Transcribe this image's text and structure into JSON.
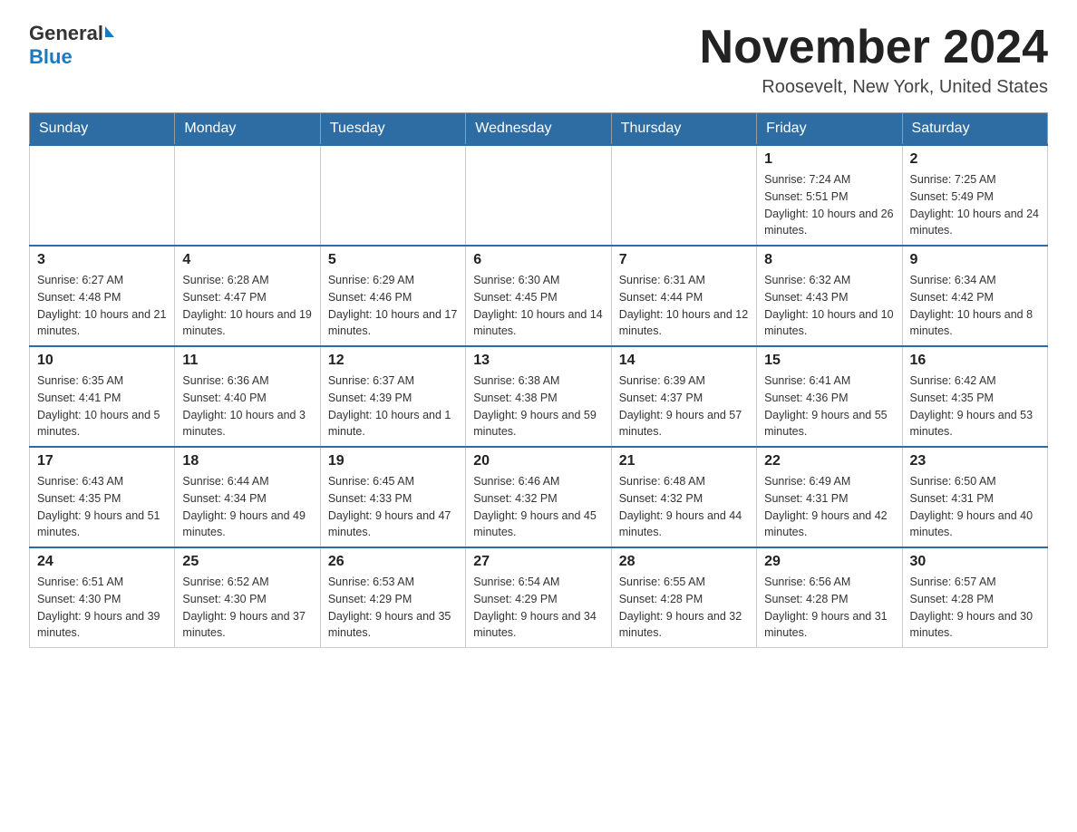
{
  "logo": {
    "general": "General",
    "blue": "Blue"
  },
  "title": "November 2024",
  "location": "Roosevelt, New York, United States",
  "days_of_week": [
    "Sunday",
    "Monday",
    "Tuesday",
    "Wednesday",
    "Thursday",
    "Friday",
    "Saturday"
  ],
  "weeks": [
    [
      {
        "day": "",
        "info": ""
      },
      {
        "day": "",
        "info": ""
      },
      {
        "day": "",
        "info": ""
      },
      {
        "day": "",
        "info": ""
      },
      {
        "day": "",
        "info": ""
      },
      {
        "day": "1",
        "info": "Sunrise: 7:24 AM\nSunset: 5:51 PM\nDaylight: 10 hours and 26 minutes."
      },
      {
        "day": "2",
        "info": "Sunrise: 7:25 AM\nSunset: 5:49 PM\nDaylight: 10 hours and 24 minutes."
      }
    ],
    [
      {
        "day": "3",
        "info": "Sunrise: 6:27 AM\nSunset: 4:48 PM\nDaylight: 10 hours and 21 minutes."
      },
      {
        "day": "4",
        "info": "Sunrise: 6:28 AM\nSunset: 4:47 PM\nDaylight: 10 hours and 19 minutes."
      },
      {
        "day": "5",
        "info": "Sunrise: 6:29 AM\nSunset: 4:46 PM\nDaylight: 10 hours and 17 minutes."
      },
      {
        "day": "6",
        "info": "Sunrise: 6:30 AM\nSunset: 4:45 PM\nDaylight: 10 hours and 14 minutes."
      },
      {
        "day": "7",
        "info": "Sunrise: 6:31 AM\nSunset: 4:44 PM\nDaylight: 10 hours and 12 minutes."
      },
      {
        "day": "8",
        "info": "Sunrise: 6:32 AM\nSunset: 4:43 PM\nDaylight: 10 hours and 10 minutes."
      },
      {
        "day": "9",
        "info": "Sunrise: 6:34 AM\nSunset: 4:42 PM\nDaylight: 10 hours and 8 minutes."
      }
    ],
    [
      {
        "day": "10",
        "info": "Sunrise: 6:35 AM\nSunset: 4:41 PM\nDaylight: 10 hours and 5 minutes."
      },
      {
        "day": "11",
        "info": "Sunrise: 6:36 AM\nSunset: 4:40 PM\nDaylight: 10 hours and 3 minutes."
      },
      {
        "day": "12",
        "info": "Sunrise: 6:37 AM\nSunset: 4:39 PM\nDaylight: 10 hours and 1 minute."
      },
      {
        "day": "13",
        "info": "Sunrise: 6:38 AM\nSunset: 4:38 PM\nDaylight: 9 hours and 59 minutes."
      },
      {
        "day": "14",
        "info": "Sunrise: 6:39 AM\nSunset: 4:37 PM\nDaylight: 9 hours and 57 minutes."
      },
      {
        "day": "15",
        "info": "Sunrise: 6:41 AM\nSunset: 4:36 PM\nDaylight: 9 hours and 55 minutes."
      },
      {
        "day": "16",
        "info": "Sunrise: 6:42 AM\nSunset: 4:35 PM\nDaylight: 9 hours and 53 minutes."
      }
    ],
    [
      {
        "day": "17",
        "info": "Sunrise: 6:43 AM\nSunset: 4:35 PM\nDaylight: 9 hours and 51 minutes."
      },
      {
        "day": "18",
        "info": "Sunrise: 6:44 AM\nSunset: 4:34 PM\nDaylight: 9 hours and 49 minutes."
      },
      {
        "day": "19",
        "info": "Sunrise: 6:45 AM\nSunset: 4:33 PM\nDaylight: 9 hours and 47 minutes."
      },
      {
        "day": "20",
        "info": "Sunrise: 6:46 AM\nSunset: 4:32 PM\nDaylight: 9 hours and 45 minutes."
      },
      {
        "day": "21",
        "info": "Sunrise: 6:48 AM\nSunset: 4:32 PM\nDaylight: 9 hours and 44 minutes."
      },
      {
        "day": "22",
        "info": "Sunrise: 6:49 AM\nSunset: 4:31 PM\nDaylight: 9 hours and 42 minutes."
      },
      {
        "day": "23",
        "info": "Sunrise: 6:50 AM\nSunset: 4:31 PM\nDaylight: 9 hours and 40 minutes."
      }
    ],
    [
      {
        "day": "24",
        "info": "Sunrise: 6:51 AM\nSunset: 4:30 PM\nDaylight: 9 hours and 39 minutes."
      },
      {
        "day": "25",
        "info": "Sunrise: 6:52 AM\nSunset: 4:30 PM\nDaylight: 9 hours and 37 minutes."
      },
      {
        "day": "26",
        "info": "Sunrise: 6:53 AM\nSunset: 4:29 PM\nDaylight: 9 hours and 35 minutes."
      },
      {
        "day": "27",
        "info": "Sunrise: 6:54 AM\nSunset: 4:29 PM\nDaylight: 9 hours and 34 minutes."
      },
      {
        "day": "28",
        "info": "Sunrise: 6:55 AM\nSunset: 4:28 PM\nDaylight: 9 hours and 32 minutes."
      },
      {
        "day": "29",
        "info": "Sunrise: 6:56 AM\nSunset: 4:28 PM\nDaylight: 9 hours and 31 minutes."
      },
      {
        "day": "30",
        "info": "Sunrise: 6:57 AM\nSunset: 4:28 PM\nDaylight: 9 hours and 30 minutes."
      }
    ]
  ]
}
